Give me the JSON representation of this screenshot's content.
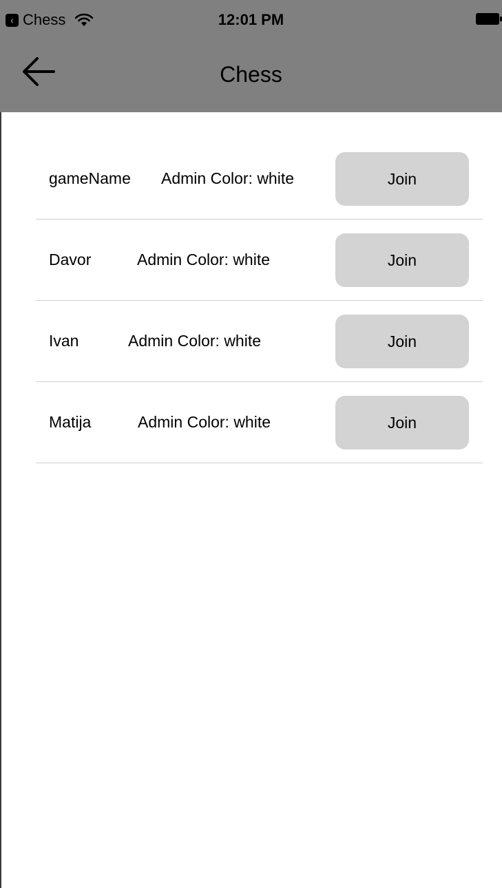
{
  "status_bar": {
    "back_app_label": "Chess",
    "time": "12:01 PM"
  },
  "nav": {
    "title": "Chess"
  },
  "games": [
    {
      "name": "gameName",
      "admin_color": "Admin Color: white",
      "join_label": "Join"
    },
    {
      "name": "Davor",
      "admin_color": "Admin Color: white",
      "join_label": "Join"
    },
    {
      "name": "Ivan",
      "admin_color": "Admin Color: white",
      "join_label": "Join"
    },
    {
      "name": "Matija",
      "admin_color": "Admin Color: white",
      "join_label": "Join"
    }
  ],
  "colors": {
    "nav_background": "#808080",
    "button_background": "#d3d3d3",
    "divider": "#cfcfcf"
  }
}
